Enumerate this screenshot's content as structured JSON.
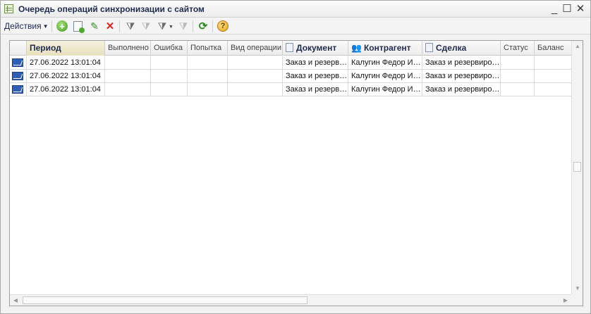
{
  "window": {
    "title": "Очередь операций синхронизации с сайтом",
    "controls": {
      "minimize": "_",
      "maximize": "☐",
      "close": "✕"
    }
  },
  "toolbar": {
    "actions_label": "Действия",
    "icons": [
      "add-icon",
      "copy-icon",
      "edit-icon",
      "delete-icon",
      "filter-icon",
      "filter-off-icon",
      "filter-list-icon",
      "clear-filter-icon",
      "refresh-icon",
      "help-icon"
    ]
  },
  "table": {
    "columns": [
      {
        "label": "Период"
      },
      {
        "label": "Выполнено"
      },
      {
        "label": "Ошибка"
      },
      {
        "label": "Попытка"
      },
      {
        "label": "Вид операции"
      },
      {
        "label": "Документ"
      },
      {
        "label": "Контрагент"
      },
      {
        "label": "Сделка"
      },
      {
        "label": "Статус"
      },
      {
        "label": "Баланс"
      }
    ],
    "rows": [
      {
        "period": "27.06.2022 13:01:04",
        "done": "",
        "error": "",
        "attempt": "",
        "op_type": "",
        "document": "Заказ и резервирование",
        "counterparty": "Калугин Федор Иванович",
        "deal": "Заказ и резервирование",
        "status": "",
        "balance": ""
      },
      {
        "period": "27.06.2022 13:01:04",
        "done": "",
        "error": "",
        "attempt": "",
        "op_type": "",
        "document": "Заказ и резервирование",
        "counterparty": "Калугин Федор Иванович",
        "deal": "Заказ и резервирование",
        "status": "",
        "balance": ""
      },
      {
        "period": "27.06.2022 13:01:04",
        "done": "",
        "error": "",
        "attempt": "",
        "op_type": "",
        "document": "Заказ и резервирование",
        "counterparty": "Калугин Федор Иванович",
        "deal": "Заказ и резервирование",
        "status": "",
        "balance": ""
      }
    ]
  }
}
